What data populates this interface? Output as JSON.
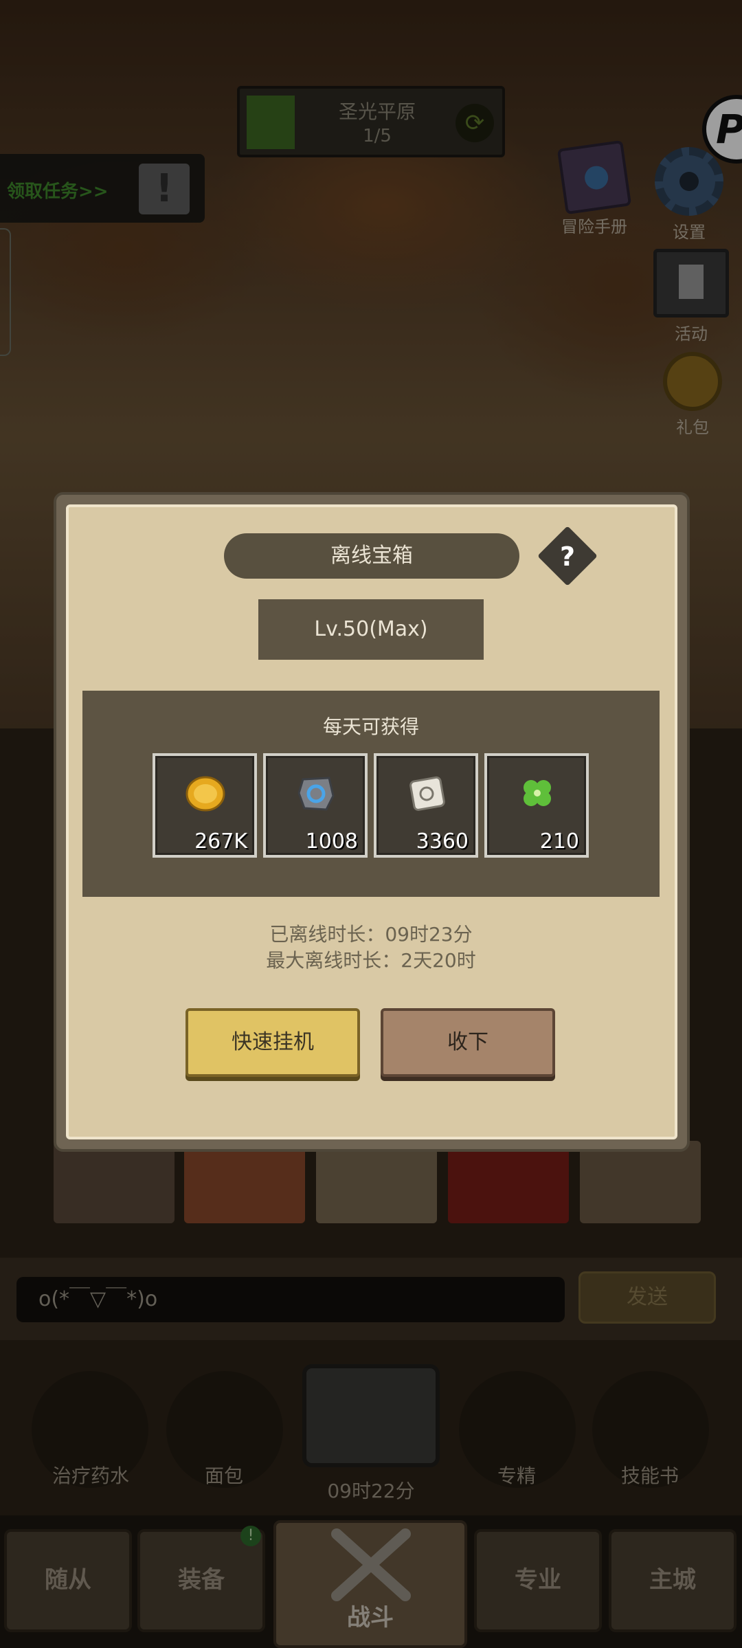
{
  "hud": {
    "stage_name": "圣光平原",
    "stage_progress": "1/5",
    "quest_label": "领取任务>>",
    "quest_mark": "!",
    "p_badge": "P"
  },
  "side_buttons": {
    "adventure_handbook": "冒险手册",
    "settings": "设置",
    "events": "活动",
    "gift_pack": "礼包"
  },
  "dialog": {
    "title": "离线宝箱",
    "help": "?",
    "level": "Lv.50(Max)",
    "reward_title": "每天可获得",
    "rewards": [
      {
        "icon": "gold-coin-icon",
        "count": "267K"
      },
      {
        "icon": "rune-stone-icon",
        "count": "1008"
      },
      {
        "icon": "scroll-icon",
        "count": "3360"
      },
      {
        "icon": "clover-icon",
        "count": "210"
      }
    ],
    "offline_time": "已离线时长：09时23分",
    "max_offline_time": "最大离线时长：2天20时",
    "quick_button": "快速挂机",
    "collect_button": "收下"
  },
  "chat": {
    "input_value": "o(*￣▽￣*)o",
    "send_label": "发送"
  },
  "items": {
    "potion": "治疗药水",
    "bread": "面包",
    "chest_timer": "09时22分",
    "specialization": "专精",
    "skill_book": "技能书"
  },
  "nav": {
    "followers": "随从",
    "equipment": "装备",
    "equipment_badge": "!",
    "battle": "战斗",
    "profession": "专业",
    "main_city": "主城"
  },
  "colors": {
    "dialog_bg": "#d9c9a5",
    "panel_dark": "#5d5443",
    "quick_button": "#e0c364",
    "collect_button": "#a5846a",
    "quest_green": "#3f8a2c"
  }
}
